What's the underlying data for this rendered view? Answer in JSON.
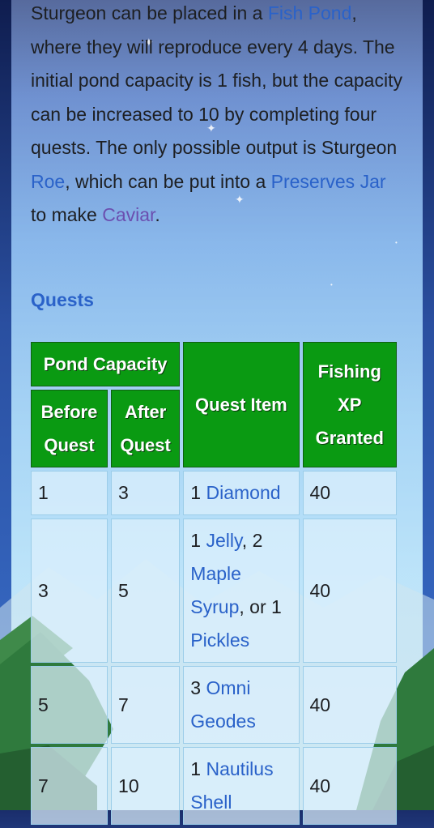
{
  "paragraph": {
    "t1": "Sturgeon can be placed in a ",
    "link_fish_pond": "Fish Pond",
    "t2": ", where they will reproduce every 4 days. The initial pond capacity is 1 fish, but the capacity can be increased to 10 by completing four quests. The only possible output is Sturgeon ",
    "link_roe": "Roe",
    "t3": ", which can be put into a ",
    "link_preserves_jar": "Preserves Jar",
    "t4": " to make ",
    "link_caviar": "Caviar",
    "t5": "."
  },
  "section_title": "Quests",
  "table": {
    "header_group": "Pond Capacity",
    "col_before": "Before Quest",
    "col_after": "After Quest",
    "col_item": "Quest Item",
    "col_xp": "Fishing XP Granted",
    "rows": [
      {
        "before": "1",
        "after": "3",
        "item_pre": "1 ",
        "item_link": "Diamond",
        "xp": "40"
      },
      {
        "before": "3",
        "after": "5",
        "xp": "40"
      },
      {
        "before": "5",
        "after": "7",
        "item_pre": "3 ",
        "item_link": "Omni Geodes",
        "xp": "40"
      },
      {
        "before": "7",
        "after": "10",
        "item_pre": "1 ",
        "item_link": "Nautilus Shell",
        "xp": "40"
      }
    ],
    "row2_item": {
      "p1": "1 ",
      "link1": "Jelly",
      "p2": ", 2 ",
      "link2": "Maple Syrup",
      "p3": ", or 1 ",
      "link3": "Pickles"
    }
  }
}
